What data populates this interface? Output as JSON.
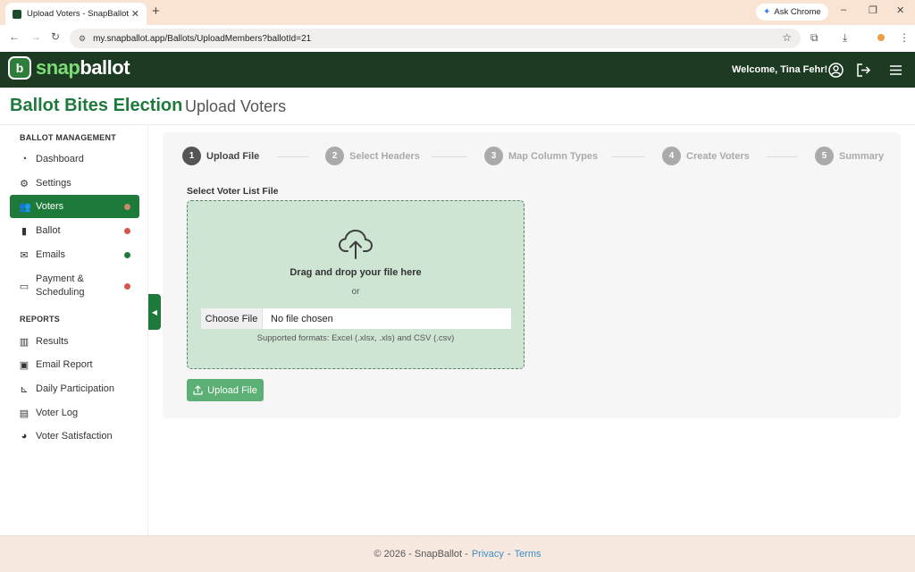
{
  "browser": {
    "tab_title": "Upload Voters - SnapBallot",
    "tab_close": "✕",
    "new_tab": "+",
    "ask_chrome": "Ask Chrome",
    "url": "my.snapballot.app/Ballots/UploadMembers?ballotId=21",
    "win_minimize": "–",
    "win_restore": "❐",
    "win_close": "✕"
  },
  "header": {
    "logo_snap": "snap",
    "logo_ballot": "ballot",
    "logo_mark": "b",
    "welcome": "Welcome, Tina Fehr!"
  },
  "page": {
    "title": "Ballot Bites Election",
    "subtitle": "Upload Voters"
  },
  "sidebar": {
    "section_management": "BALLOT MANAGEMENT",
    "section_reports": "REPORTS",
    "items": [
      {
        "label": "Dashboard",
        "icon": "dashboard-icon"
      },
      {
        "label": "Settings",
        "icon": "gear-icon"
      },
      {
        "label": "Voters",
        "icon": "users-icon",
        "dot": "#c98a6a"
      },
      {
        "label": "Ballot",
        "icon": "ballot-icon",
        "dot": "#d9534f"
      },
      {
        "label": "Emails",
        "icon": "envelope-icon",
        "dot": "#1d7a3a"
      },
      {
        "label": "Payment & Scheduling",
        "icon": "credit-card-icon",
        "dot": "#d9534f"
      },
      {
        "label": "Results",
        "icon": "bar-chart-icon"
      },
      {
        "label": "Email Report",
        "icon": "inbox-icon"
      },
      {
        "label": "Daily Participation",
        "icon": "line-chart-icon"
      },
      {
        "label": "Voter Log",
        "icon": "clipboard-icon"
      },
      {
        "label": "Voter Satisfaction",
        "icon": "pie-chart-icon"
      }
    ]
  },
  "steps": [
    {
      "num": "1",
      "label": "Upload File",
      "active": true
    },
    {
      "num": "2",
      "label": "Select Headers",
      "active": false
    },
    {
      "num": "3",
      "label": "Map Column Types",
      "active": false
    },
    {
      "num": "4",
      "label": "Create Voters",
      "active": false
    },
    {
      "num": "5",
      "label": "Summary",
      "active": false
    }
  ],
  "upload": {
    "field_label": "Select Voter List File",
    "drop_text": "Drag and drop your file here",
    "or_text": "or",
    "choose_file": "Choose File",
    "file_status": "No file chosen",
    "formats": "Supported formats: Excel (.xlsx, .xls) and CSV (.csv)",
    "button": "Upload File"
  },
  "footer": {
    "copyright": "© 2026 - SnapBallot -",
    "privacy": "Privacy",
    "dash": "-",
    "terms": "Terms"
  },
  "colors": {
    "header_bg": "#1c3b22",
    "brand_green": "#1d7a3a",
    "dropzone_bg": "#cfe5d4",
    "upload_button": "#5cb075"
  }
}
